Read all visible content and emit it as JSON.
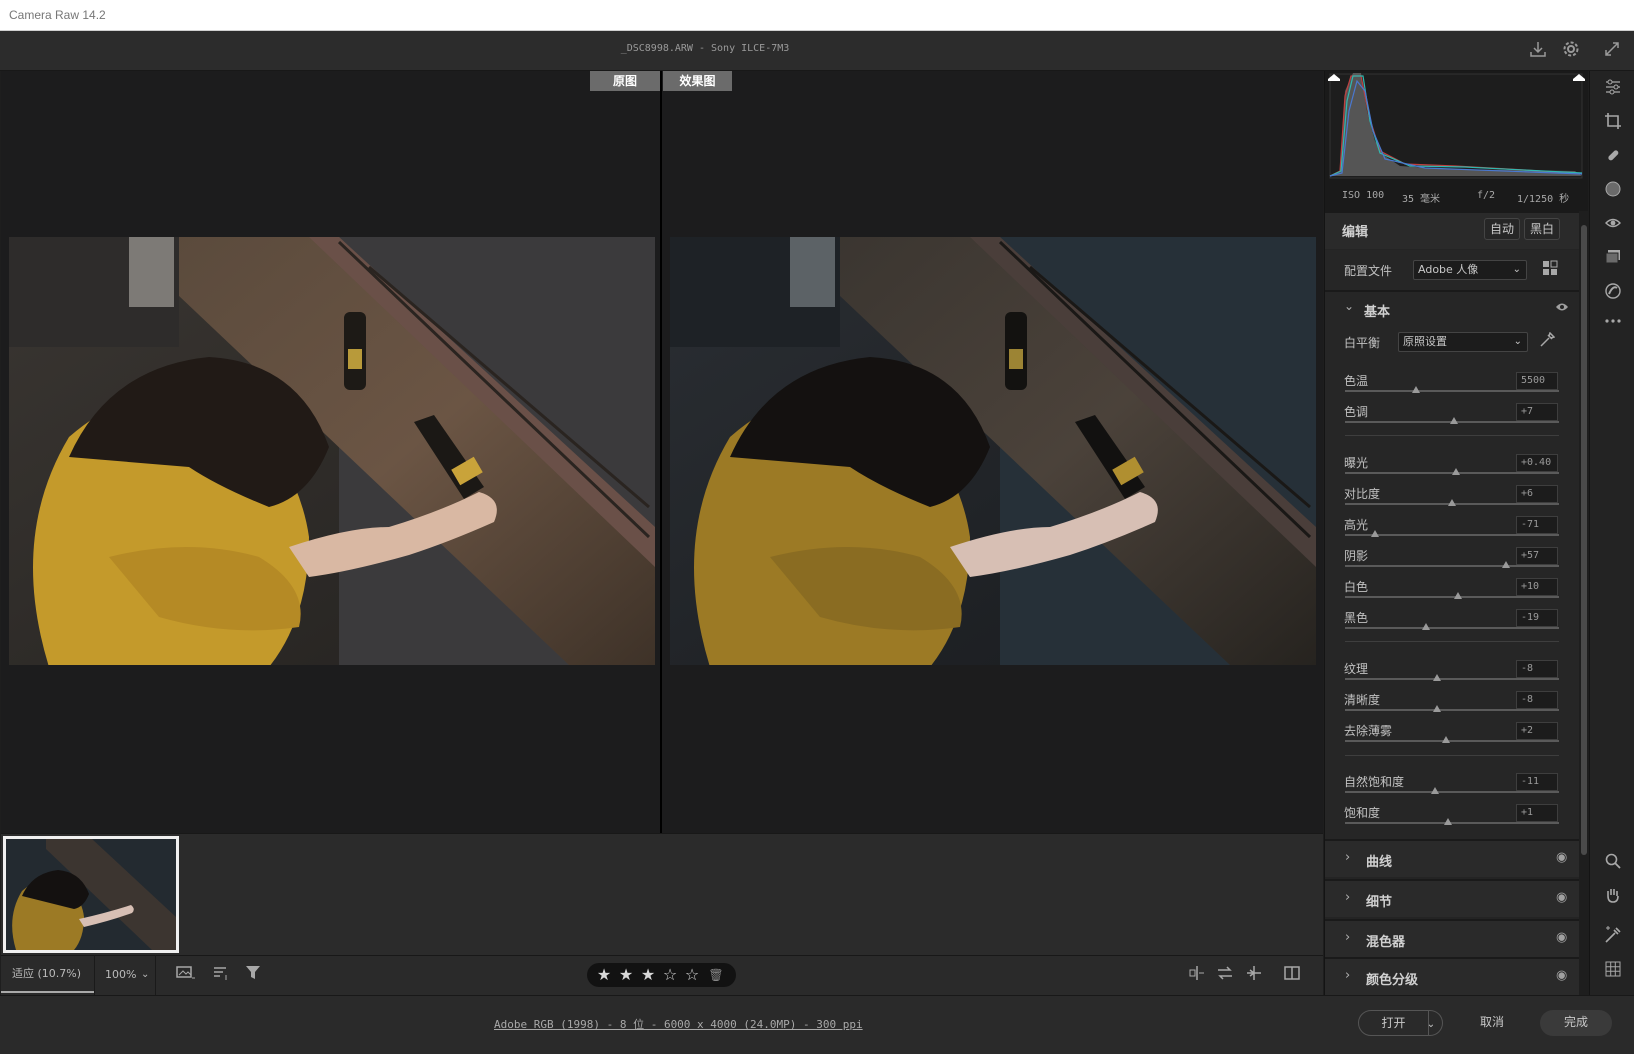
{
  "window": {
    "title": "Camera Raw 14.2"
  },
  "header": {
    "file_info": "_DSC8998.ARW -  Sony ILCE-7M3"
  },
  "viewer": {
    "before_label": "原图",
    "after_label": "效果图"
  },
  "toolbar": {
    "zoom_fit": "适应 (10.7%)",
    "zoom_100": "100%",
    "rating_stars": 3,
    "rating_max": 5
  },
  "histogram": {
    "iso": "ISO 100",
    "focal": "35 毫米",
    "aperture": "f/2",
    "shutter": "1/1250 秒"
  },
  "edit": {
    "title": "编辑",
    "auto": "自动",
    "bw": "黑白",
    "profile_label": "配置文件",
    "profile_value": "Adobe 人像"
  },
  "basic": {
    "title": "基本",
    "wb_label": "白平衡",
    "wb_value": "原照设置",
    "sliders": [
      {
        "label": "色温",
        "value": "5500"
      },
      {
        "label": "色调",
        "value": "+7"
      },
      {
        "label": "曝光",
        "value": "+0.40"
      },
      {
        "label": "对比度",
        "value": "+6"
      },
      {
        "label": "高光",
        "value": "-71"
      },
      {
        "label": "阴影",
        "value": "+57"
      },
      {
        "label": "白色",
        "value": "+10"
      },
      {
        "label": "黑色",
        "value": "-19"
      },
      {
        "label": "纹理",
        "value": "-8"
      },
      {
        "label": "清晰度",
        "value": "-8"
      },
      {
        "label": "去除薄雾",
        "value": "+2"
      },
      {
        "label": "自然饱和度",
        "value": "-11"
      },
      {
        "label": "饱和度",
        "value": "+1"
      }
    ]
  },
  "panels": {
    "curve": "曲线",
    "detail": "细节",
    "mixer": "混色器",
    "grading": "颜色分级"
  },
  "status": {
    "info": "Adobe RGB (1998) - 8 位 - 6000 x 4000 (24.0MP) - 300 ppi"
  },
  "buttons": {
    "open": "打开",
    "cancel": "取消",
    "done": "完成"
  },
  "icons": {
    "header": [
      "save-icon",
      "settings-icon",
      "fullscreen-icon"
    ],
    "tools": [
      "edit-icon",
      "crop-icon",
      "heal-icon",
      "mask-icon",
      "redeye-icon",
      "snapshots-icon",
      "presets-icon",
      "more-icon",
      "zoom-icon",
      "hand-icon",
      "sampler-icon",
      "grid-icon"
    ]
  }
}
